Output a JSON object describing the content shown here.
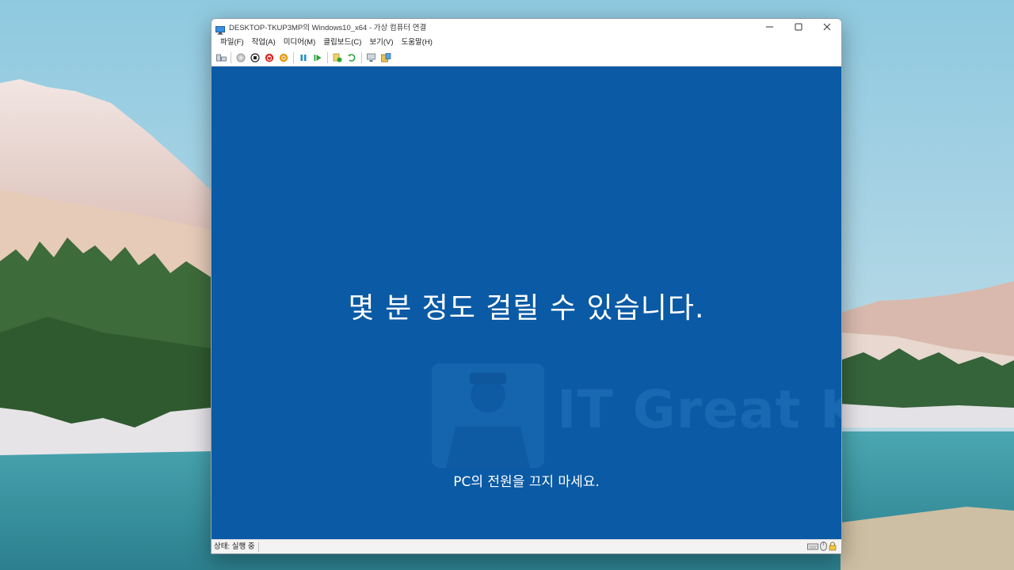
{
  "window": {
    "title": "DESKTOP-TKUP3MP의 Windows10_x64 - 가상 컴퓨터 연결",
    "controls": [
      "minimize-icon",
      "maximize-icon",
      "close-icon"
    ]
  },
  "menu": {
    "items": [
      "파일(F)",
      "작업(A)",
      "미디어(M)",
      "클립보드(C)",
      "보기(V)",
      "도움말(H)"
    ]
  },
  "toolbar": {
    "buttons": [
      "ctrl-alt-del-icon",
      "start-icon",
      "turn-off-icon",
      "shutdown-icon",
      "save-icon",
      "pause-icon",
      "resume-icon",
      "checkpoint-icon",
      "revert-icon",
      "enhanced-session-icon",
      "share-icon"
    ]
  },
  "vm_screen": {
    "main_text": "몇 분 정도 걸릴 수 있습니다.",
    "sub_text": "PC의 전원을 끄지 마세요.",
    "background_color": "#0a5aa5",
    "watermark": {
      "text": "IT Great King"
    }
  },
  "statusbar": {
    "status": "상태: 실행 중",
    "icons": [
      "keyboard-icon",
      "mouse-icon",
      "lock-icon"
    ]
  }
}
